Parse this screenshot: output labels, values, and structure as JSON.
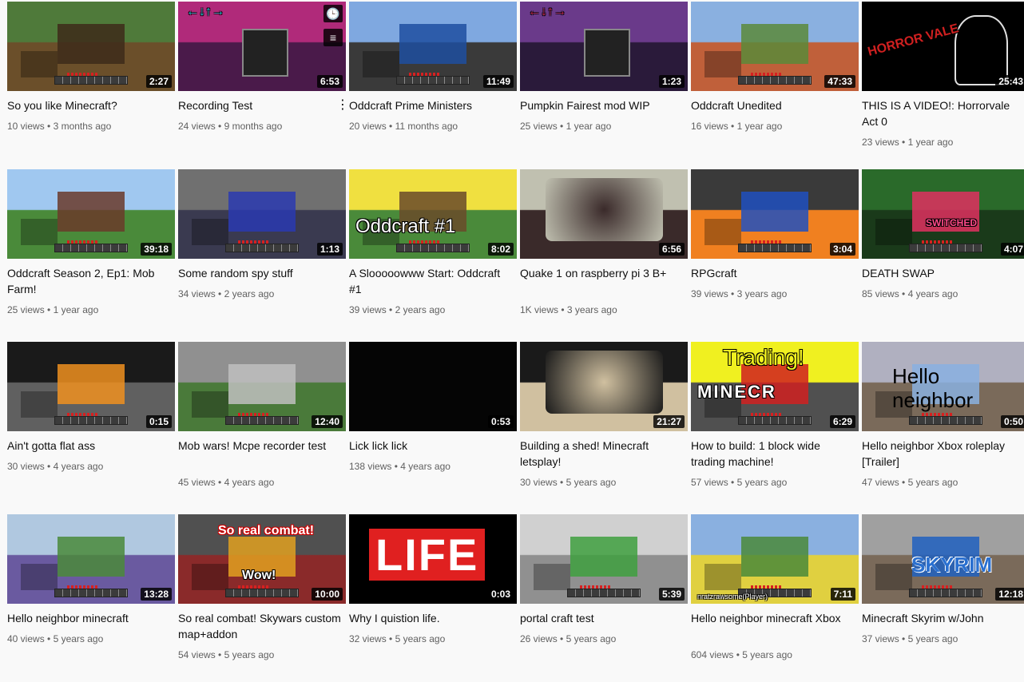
{
  "videos": [
    {
      "title": "So you like Minecraft?",
      "views": "10 views",
      "age": "3 months ago",
      "duration": "2:27",
      "thumb": "minecraft-farm",
      "colors": [
        "#4f7a3a",
        "#6b4f2a",
        "#3d2a1a"
      ]
    },
    {
      "title": "Recording Test",
      "views": "24 views",
      "age": "9 months ago",
      "duration": "6:53",
      "thumb": "fnf-stage",
      "colors": [
        "#b02a7a",
        "#4a1a4a",
        "#20c0d0"
      ],
      "menu": "⋮",
      "icons": [
        "clock-icon",
        "queue-icon"
      ]
    },
    {
      "title": "Oddcraft Prime Ministers",
      "views": "20 views",
      "age": "11 months ago",
      "duration": "11:49",
      "thumb": "minecraft-arch",
      "colors": [
        "#7fa8e0",
        "#3a3a3a",
        "#1e4fa0"
      ]
    },
    {
      "title": "Pumpkin Fairest mod WIP",
      "views": "25 views",
      "age": "1 year ago",
      "duration": "1:23",
      "thumb": "fnf-stage",
      "colors": [
        "#6a3a8a",
        "#2a1a3a",
        "#c02a4a"
      ]
    },
    {
      "title": "Oddcraft Unedited",
      "views": "16 views",
      "age": "1 year ago",
      "duration": "47:33",
      "thumb": "minecraft-tree",
      "colors": [
        "#8ab0e0",
        "#c0603a",
        "#5a8a3a"
      ]
    },
    {
      "title": "THIS IS A VIDEO!: Horrorvale Act 0",
      "views": "23 views",
      "age": "1 year ago",
      "duration": "25:43",
      "thumb": "horror-art",
      "colors": [
        "#000000",
        "#d02020",
        "#e0e0e0"
      ],
      "overlay": "HORROR VALE"
    },
    {
      "title": "Oddcraft Season 2, Ep1: Mob Farm!",
      "views": "25 views",
      "age": "1 year ago",
      "duration": "39:18",
      "thumb": "minecraft-landscape",
      "colors": [
        "#a0c8f0",
        "#4a8a3a",
        "#6a3a2a"
      ]
    },
    {
      "title": "Some random spy stuff",
      "views": "34 views",
      "age": "2 years ago",
      "duration": "1:13",
      "thumb": "minecraft-hall",
      "colors": [
        "#707070",
        "#3a3a50",
        "#2a3ab0"
      ]
    },
    {
      "title": "A Slooooowww Start: Oddcraft #1",
      "views": "39 views",
      "age": "2 years ago",
      "duration": "8:02",
      "thumb": "minecraft-sign",
      "colors": [
        "#f0e040",
        "#4a8a3a",
        "#6a4a2a"
      ],
      "overlay": "Oddcraft #1"
    },
    {
      "title": "Quake 1 on raspberry pi 3 B+",
      "views": "1K views",
      "age": "3 years ago",
      "duration": "6:56",
      "thumb": "photo-monitor",
      "colors": [
        "#c0c0b0",
        "#3a2a2a",
        "#7a5a4a"
      ]
    },
    {
      "title": "RPGcraft",
      "views": "39 views",
      "age": "3 years ago",
      "duration": "3:04",
      "thumb": "minecraft-fire",
      "colors": [
        "#3a3a3a",
        "#f08020",
        "#2050c0"
      ]
    },
    {
      "title": "DEATH SWAP",
      "views": "85 views",
      "age": "4 years ago",
      "duration": "4:07",
      "thumb": "minecraft-tunnel",
      "colors": [
        "#2a6a2a",
        "#1a3a1a",
        "#e03060"
      ],
      "overlay": "SWITCHED"
    },
    {
      "title": "Ain't gotta flat ass",
      "views": "30 views",
      "age": "4 years ago",
      "duration": "0:15",
      "thumb": "minecraft-night",
      "colors": [
        "#1a1a1a",
        "#606060",
        "#f09020"
      ]
    },
    {
      "title": "Mob wars! Mcpe recorder test",
      "views": "45 views",
      "age": "4 years ago",
      "duration": "12:40",
      "thumb": "minecraft-arena",
      "colors": [
        "#909090",
        "#4a7a3a",
        "#c0c0c0"
      ]
    },
    {
      "title": "Lick lick lick",
      "views": "138 views",
      "age": "4 years ago",
      "duration": "0:53",
      "thumb": "dark-photo",
      "colors": [
        "#050505",
        "#1a1a1a",
        "#3a3a3a"
      ]
    },
    {
      "title": "Building a shed! Minecraft letsplay!",
      "views": "30 views",
      "age": "5 years ago",
      "duration": "21:27",
      "thumb": "dog-photo",
      "colors": [
        "#1a1a1a",
        "#d0c0a0",
        "#2a2a2a"
      ]
    },
    {
      "title": "How to build: 1 block wide trading machine!",
      "views": "57 views",
      "age": "5 years ago",
      "duration": "6:29",
      "thumb": "minecraft-logo",
      "colors": [
        "#f0f020",
        "#505050",
        "#d02020"
      ],
      "overlay": "Trading!",
      "overlay2": "MINECR"
    },
    {
      "title": "Hello neighbor Xbox roleplay [Trailer]",
      "views": "47 views",
      "age": "5 years ago",
      "duration": "0:50",
      "thumb": "minecraft-house",
      "colors": [
        "#b0b0c0",
        "#7a6a5a",
        "#8ab0e0"
      ],
      "overlay": "Hello neighbor"
    },
    {
      "title": "Hello neighbor minecraft",
      "views": "40 views",
      "age": "5 years ago",
      "duration": "13:28",
      "thumb": "minecraft-blur",
      "colors": [
        "#b0c8e0",
        "#6a5aa0",
        "#4a8a3a"
      ]
    },
    {
      "title": "So real combat! Skywars custom map+addon",
      "views": "54 views",
      "age": "5 years ago",
      "duration": "10:00",
      "thumb": "minecraft-combat",
      "colors": [
        "#505050",
        "#8a2a2a",
        "#e0a020"
      ],
      "overlay": "So real combat!",
      "overlay2": "Wow!"
    },
    {
      "title": "Why I quistion life.",
      "views": "32 views",
      "age": "5 years ago",
      "duration": "0:03",
      "thumb": "life-logo",
      "colors": [
        "#000000",
        "#e02020",
        "#ffffff"
      ],
      "overlay": "LIFE"
    },
    {
      "title": "portal craft test",
      "views": "26 views",
      "age": "5 years ago",
      "duration": "5:39",
      "thumb": "minecraft-glass",
      "colors": [
        "#d0d0d0",
        "#909090",
        "#40a040"
      ]
    },
    {
      "title": "Hello neighbor minecraft Xbox",
      "views": "604 views",
      "age": "5 years ago",
      "duration": "7:11",
      "thumb": "minecraft-yellowhouse",
      "colors": [
        "#8ab0e0",
        "#e0d040",
        "#4a8a3a"
      ],
      "overlay": "nratzrawsome(Player)"
    },
    {
      "title": "Minecraft Skyrim w/John",
      "views": "37 views",
      "age": "5 years ago",
      "duration": "12:18",
      "thumb": "minecraft-skyrim",
      "colors": [
        "#a0a0a0",
        "#7a6a5a",
        "#2060c0"
      ],
      "overlay": "SKYRIM"
    }
  ]
}
